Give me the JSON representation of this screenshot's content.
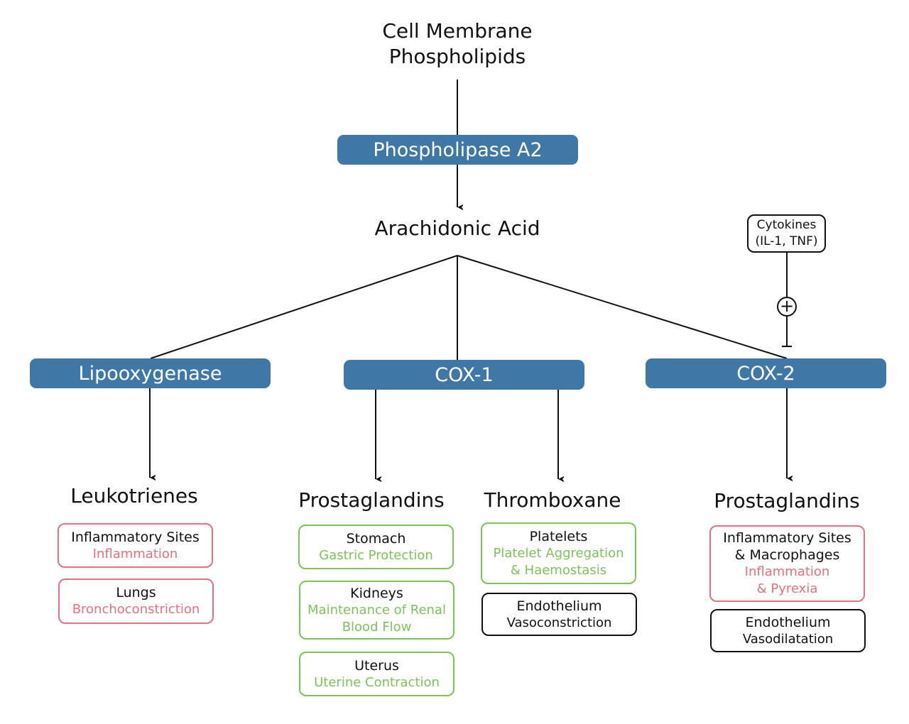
{
  "source": {
    "line1": "Cell Membrane",
    "line2": "Phospholipids"
  },
  "enzymes": {
    "pla2": "Phospholipase A2",
    "lox": "Lipooxygenase",
    "cox1": "COX-1",
    "cox2": "COX-2"
  },
  "intermediate": "Arachidonic Acid",
  "modulator": {
    "line1": "Cytokines",
    "line2": "(IL-1, TNF)",
    "effect_symbol": "+"
  },
  "products": {
    "leukotrienes": "Leukotrienes",
    "prostaglandins1": "Prostaglandins",
    "thromboxane": "Thromboxane",
    "prostaglandins2": "Prostaglandins"
  },
  "effects": {
    "lox": [
      {
        "site": "Inflammatory Sites",
        "effect": "Inflammation"
      },
      {
        "site": "Lungs",
        "effect": "Bronchoconstriction"
      }
    ],
    "cox1_pg": [
      {
        "site": "Stomach",
        "effect": "Gastric Protection"
      },
      {
        "site": "Kidneys",
        "effect": "Maintenance of Renal",
        "effect2": "Blood Flow"
      },
      {
        "site": "Uterus",
        "effect": "Uterine Contraction"
      }
    ],
    "cox1_tx": [
      {
        "site": "Platelets",
        "effect": "Platelet Aggregation",
        "effect2": "& Haemostasis"
      },
      {
        "site": "Endothelium",
        "effect": "Vasoconstriction"
      }
    ],
    "cox2": [
      {
        "site": "Inflammatory Sites",
        "site2": "& Macrophages",
        "effect": "Inflammation",
        "effect2": "& Pyrexia"
      },
      {
        "site": "Endothelium",
        "effect": "Vasodilatation"
      }
    ]
  },
  "colors": {
    "enzyme": "#3f77a6",
    "inflammatory": "#e8707f",
    "protective": "#7cc35a",
    "vascular": "#111111"
  }
}
